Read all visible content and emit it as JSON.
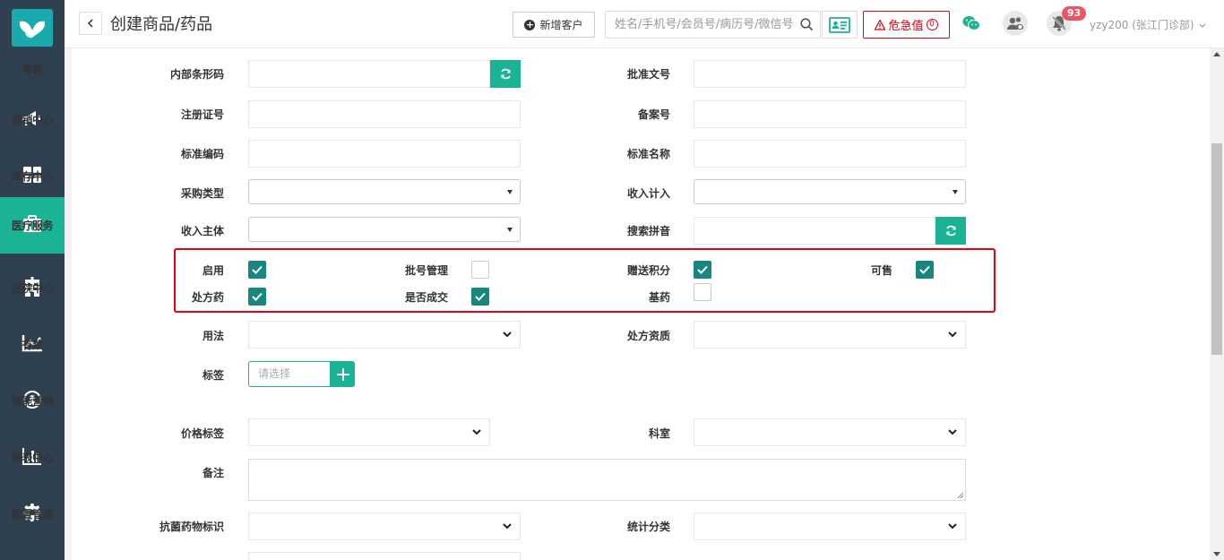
{
  "sidebar": {
    "items": [
      {
        "label": "零售",
        "icon": "retail"
      },
      {
        "label": "营销中心",
        "icon": "megaphone-icon"
      },
      {
        "label": "库存中心",
        "icon": "grid-icon"
      },
      {
        "label": "医疗服务",
        "icon": "medical-kit-icon",
        "active": true
      },
      {
        "label": "住院中心",
        "icon": "hospital-icon"
      },
      {
        "label": "有数",
        "icon": "line-chart-icon"
      },
      {
        "label": "智能营销",
        "icon": "smart-marketing-icon"
      },
      {
        "label": "报表中心",
        "icon": "bar-chart-icon"
      },
      {
        "label": "配置管理",
        "icon": "gear-icon"
      }
    ]
  },
  "header": {
    "title": "创建商品/药品",
    "new_customer": "新增客户",
    "search_placeholder": "姓名/手机号/会员号/病历号/微信号",
    "critical_label": "危急值",
    "critical_count": "0",
    "notification_count": "93",
    "user": "yzy200 (张江门诊部)"
  },
  "form": {
    "internal_barcode": "内部条形码",
    "approval_no": "批准文号",
    "registration_no": "注册证号",
    "record_no": "备案号",
    "standard_code": "标准编码",
    "standard_name": "标准名称",
    "purchase_type": "采购类型",
    "income_account": "收入计入",
    "income_subject": "收入主体",
    "search_pinyin": "搜索拼音",
    "enable": "启用",
    "batch_mgmt": "批号管理",
    "gift_points": "赠送积分",
    "sellable": "可售",
    "prescription": "处方药",
    "deal": "是否成交",
    "essential": "基药",
    "usage": "用法",
    "rx_qualification": "处方资质",
    "tags": "标签",
    "tags_placeholder": "请选择",
    "price_tag": "价格标签",
    "department": "科室",
    "remark": "备注",
    "antibacterial": "抗菌药物标识",
    "stat_category": "统计分类"
  },
  "checkboxes": {
    "enable": true,
    "batch_mgmt": false,
    "gift_points": true,
    "sellable": true,
    "prescription": true,
    "deal": true,
    "essential": false
  },
  "colors": {
    "sidebar_bg": "#2f4050",
    "accent": "#1ab394",
    "checkbox": "#18877e",
    "alert": "#e60012"
  }
}
